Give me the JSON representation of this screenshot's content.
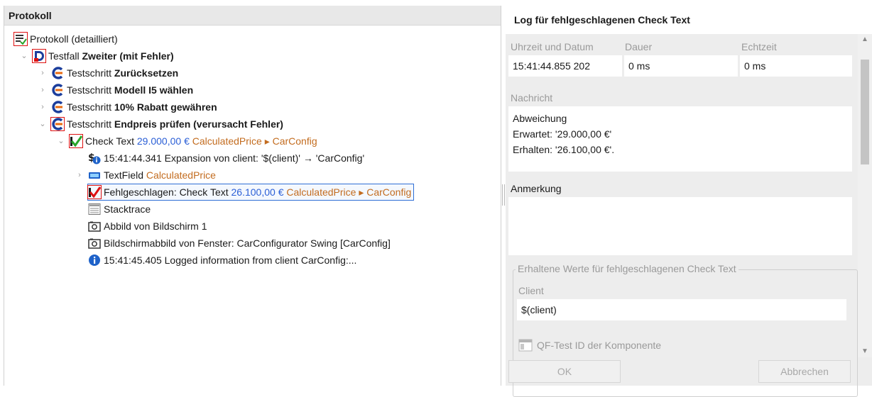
{
  "left": {
    "title": "Protokoll",
    "tree": [
      {
        "icon": "log-icon",
        "prefix": "Protokoll (detailliert)",
        "bold": "",
        "value": "",
        "path": ""
      },
      {
        "icon": "testcase-error-icon",
        "prefix": "Testfall ",
        "bold": "Zweiter (mit Fehler)",
        "value": "",
        "path": ""
      },
      {
        "icon": "teststep-icon",
        "prefix": "Testschritt ",
        "bold": "Zurücksetzen",
        "value": "",
        "path": ""
      },
      {
        "icon": "teststep-icon",
        "prefix": "Testschritt ",
        "bold": "Modell I5 wählen",
        "value": "",
        "path": ""
      },
      {
        "icon": "teststep-icon",
        "prefix": "Testschritt ",
        "bold": "10% Rabatt gewähren",
        "value": "",
        "path": ""
      },
      {
        "icon": "teststep-error-icon",
        "prefix": "Testschritt ",
        "bold": "Endpreis prüfen (verursacht Fehler)",
        "value": "",
        "path": ""
      },
      {
        "icon": "check-error-icon",
        "prefix": "Check Text ",
        "bold": "",
        "value": "29.000,00 €",
        "path": "CalculatedPrice ▸ CarConfig"
      },
      {
        "icon": "variable-info-icon",
        "prefix": "15:41:44.341 Expansion von client: '$(client)' → 'CarConfig'",
        "bold": "",
        "value": "",
        "path": ""
      },
      {
        "icon": "textfield-icon",
        "prefix": "TextField ",
        "bold": "",
        "value": "",
        "path": "CalculatedPrice"
      },
      {
        "icon": "check-failed-icon",
        "prefix": "Fehlgeschlagen: Check Text ",
        "bold": "",
        "value": "26.100,00 €",
        "path": "CalculatedPrice ▸ CarConfig"
      },
      {
        "icon": "stacktrace-icon",
        "prefix": "Stacktrace",
        "bold": "",
        "value": "",
        "path": ""
      },
      {
        "icon": "screenshot-icon",
        "prefix": "Abbild von Bildschirm 1",
        "bold": "",
        "value": "",
        "path": ""
      },
      {
        "icon": "screenshot-icon",
        "prefix": "Bildschirmabbild von Fenster: CarConfigurator Swing [CarConfig]",
        "bold": "",
        "value": "",
        "path": ""
      },
      {
        "icon": "info-icon",
        "prefix": "15:41:45.405 Logged information from client CarConfig:...",
        "bold": "",
        "value": "",
        "path": ""
      }
    ]
  },
  "right": {
    "title": "Log für fehlgeschlagenen Check Text",
    "time_label": "Uhrzeit und Datum",
    "time_value": "15:41:44.855  202",
    "duration_label": "Dauer",
    "duration_value": "0 ms",
    "realtime_label": "Echtzeit",
    "realtime_value": "0 ms",
    "message_label": "Nachricht",
    "message_lines": [
      "Abweichung",
      "Erwartet: '29.000,00 €'",
      "Erhalten: '26.100,00 €'."
    ],
    "comment_label": "Anmerkung",
    "group_title": "Erhaltene Werte für fehlgeschlagenen Check Text",
    "client_label": "Client",
    "client_value": "$(client)",
    "component_label": "QF-Test ID der Komponente",
    "ok_label": "OK",
    "cancel_label": "Abbrechen"
  }
}
